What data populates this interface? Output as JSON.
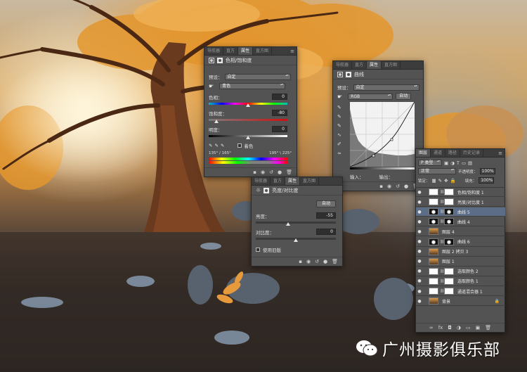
{
  "photo": {
    "description_colors": {
      "foliage": "#e09a3a",
      "sky": "#dfe6ee",
      "ground": "#2c2420"
    }
  },
  "hue_panel": {
    "tabs": [
      "导航器",
      "直方",
      "属性",
      "直方图"
    ],
    "active_tab": 2,
    "title": "色相/饱和度",
    "preset_label": "预设：",
    "preset_value": "自定",
    "channel_value": "青色",
    "hue_label": "色相：",
    "hue_value": "0",
    "sat_label": "饱和度：",
    "sat_value": "-80",
    "light_label": "明度：",
    "light_value": "0",
    "colorize_label": "着色",
    "range_left": "135° / 165°",
    "range_right": "195° \\ 225°"
  },
  "curves_panel": {
    "tabs": [
      "导航器",
      "直方",
      "属性",
      "直方图"
    ],
    "active_tab": 2,
    "title": "曲线",
    "preset_label": "预设：",
    "preset_value": "自定",
    "channel_value": "RGB",
    "auto_label": "自动",
    "input_label": "输入：",
    "output_label": "输出："
  },
  "brightness_panel": {
    "tabs": [
      "导航器",
      "直方",
      "属性",
      "直方图"
    ],
    "active_tab": 2,
    "title": "亮度/对比度",
    "auto_label": "自动",
    "brightness_label": "亮度：",
    "brightness_value": "-55",
    "contrast_label": "对比度：",
    "contrast_value": "0",
    "legacy_label": "使用旧版"
  },
  "layers_panel": {
    "tabs": [
      "图层",
      "通道",
      "路径",
      "历史记录"
    ],
    "active_tab": 0,
    "filter_kind": "P 类型",
    "blend_mode": "正常",
    "opacity_label": "不透明度：",
    "opacity_value": "100%",
    "lock_label": "锁定：",
    "fill_label": "填充：",
    "fill_value": "100%",
    "layers": [
      {
        "name": "色相/饱和度 1",
        "thumb": "adj",
        "selected": false
      },
      {
        "name": "亮度/对比度 1",
        "thumb": "adj",
        "selected": false
      },
      {
        "name": "曲线 5",
        "thumb": "mask-dark",
        "selected": true
      },
      {
        "name": "曲线 4",
        "thumb": "mask-dark",
        "selected": false
      },
      {
        "name": "图层 4",
        "thumb": "photo",
        "selected": false
      },
      {
        "name": "曲线 6",
        "thumb": "mask-dark",
        "selected": false
      },
      {
        "name": "图层 2 拷贝 3",
        "thumb": "photo",
        "selected": false
      },
      {
        "name": "图层 1",
        "thumb": "photo",
        "selected": false
      },
      {
        "name": "选取颜色 2",
        "thumb": "white",
        "selected": false
      },
      {
        "name": "选取颜色 1",
        "thumb": "white",
        "selected": false
      },
      {
        "name": "通道混合器 1",
        "thumb": "white",
        "selected": false
      },
      {
        "name": "背景",
        "thumb": "photo",
        "selected": false
      }
    ]
  },
  "watermark": {
    "text": "广州摄影俱乐部"
  }
}
